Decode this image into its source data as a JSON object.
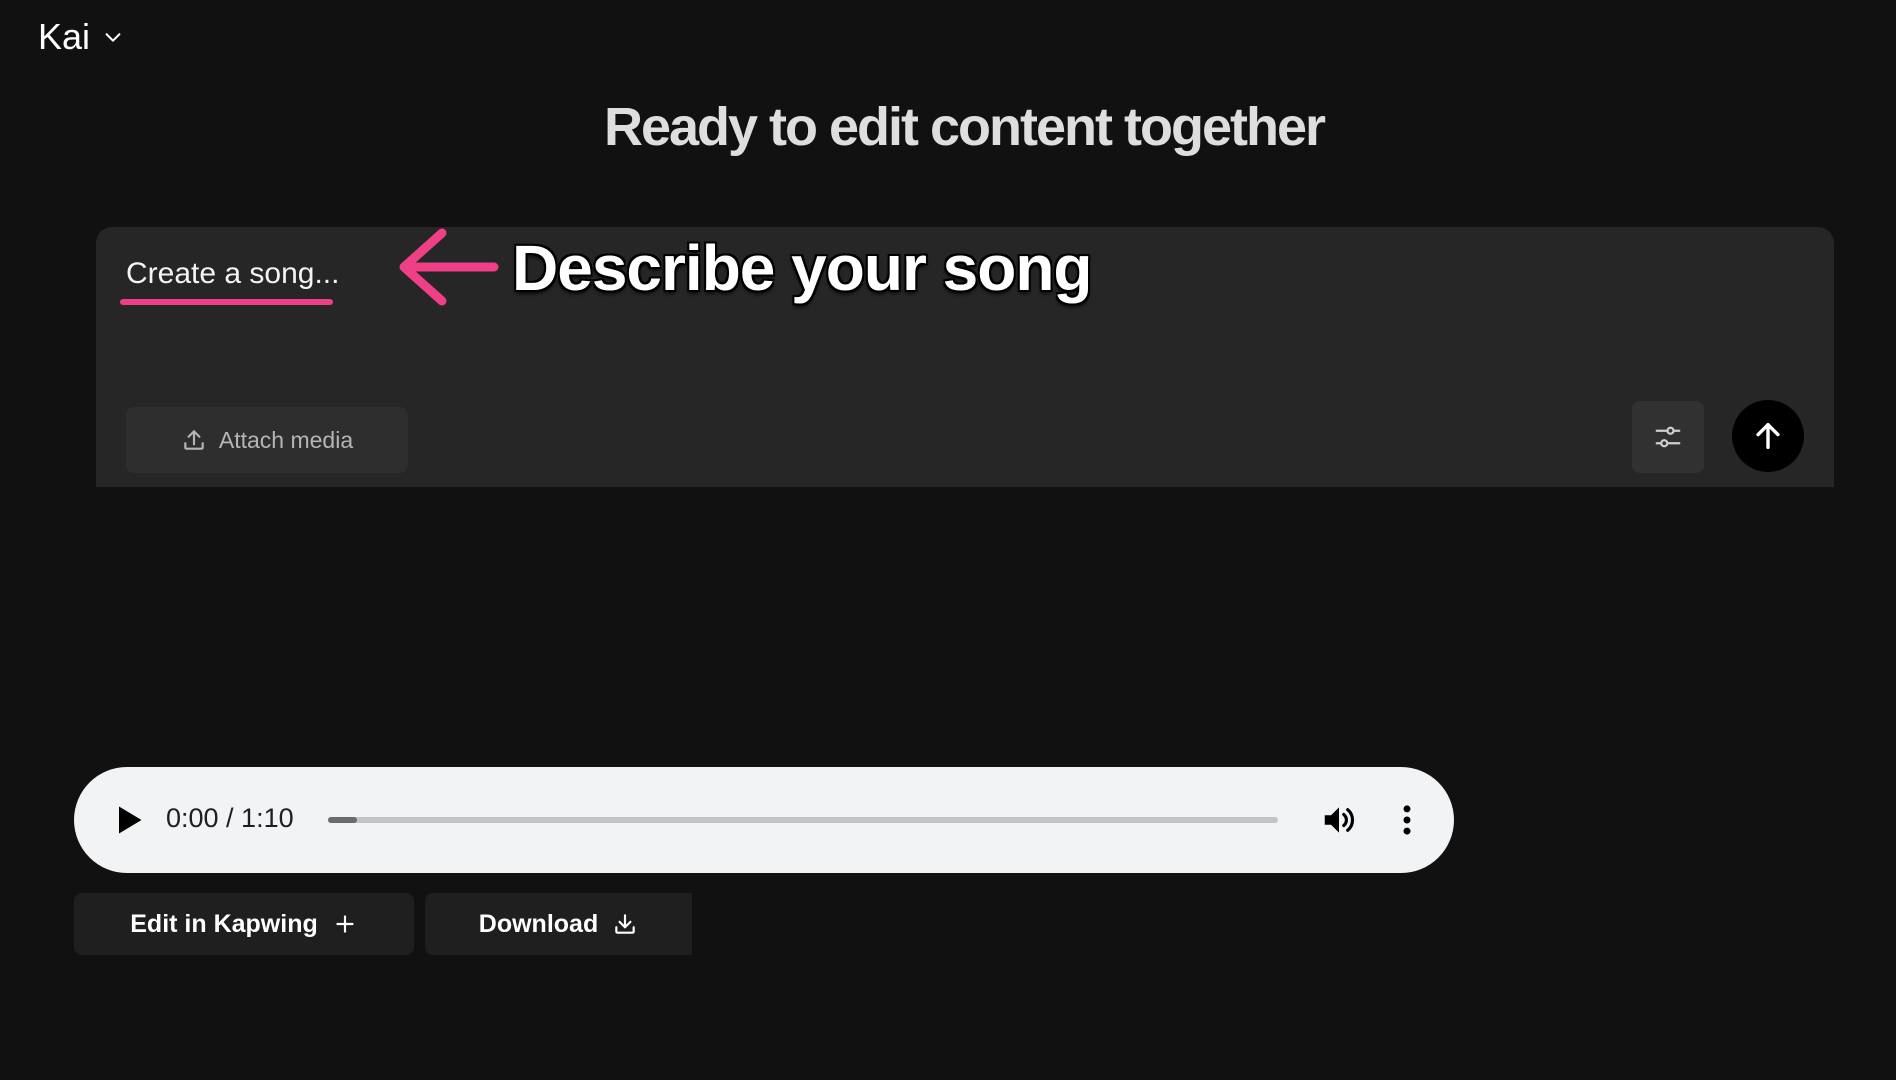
{
  "workspace": {
    "name": "Kai",
    "icon": "chevron-down-icon"
  },
  "page": {
    "title": "Ready to edit content together"
  },
  "composer": {
    "prompt": "Create a song...",
    "attach_label": "Attach media",
    "attach_icon": "upload-icon",
    "settings_icon": "sliders-icon",
    "send_icon": "arrow-up-icon"
  },
  "annotation": {
    "text": "Describe your song",
    "color": "#ef3f86",
    "icon": "arrow-left-icon"
  },
  "player": {
    "time": "0:00 / 1:10",
    "progress_fraction": 0.03,
    "play_icon": "play-icon",
    "volume_icon": "volume-icon",
    "more_icon": "more-vertical-icon"
  },
  "actions": {
    "edit_label": "Edit in Kapwing",
    "edit_icon": "plus-icon",
    "download_label": "Download",
    "download_icon": "download-icon"
  }
}
